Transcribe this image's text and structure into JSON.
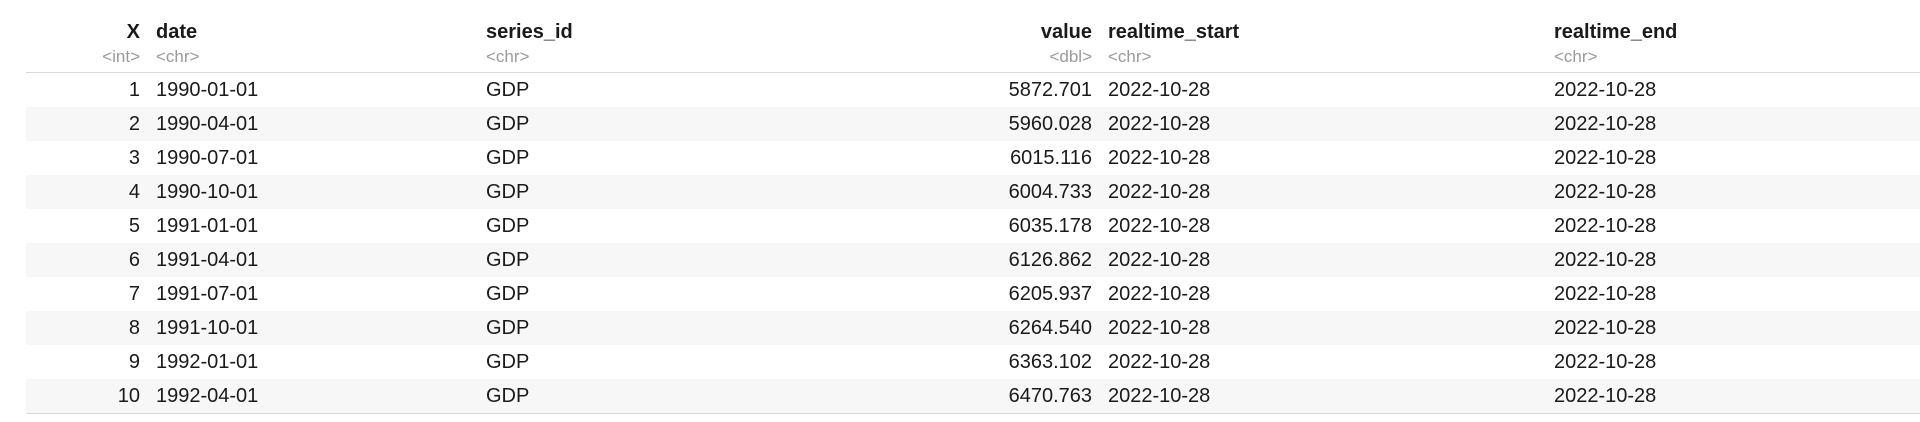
{
  "columns": [
    {
      "name": "X",
      "type": "<int>"
    },
    {
      "name": "date",
      "type": "<chr>"
    },
    {
      "name": "series_id",
      "type": "<chr>"
    },
    {
      "name": "value",
      "type": "<dbl>"
    },
    {
      "name": "realtime_start",
      "type": "<chr>"
    },
    {
      "name": "realtime_end",
      "type": "<chr>"
    }
  ],
  "rows": [
    [
      "1",
      "1990-01-01",
      "GDP",
      "5872.701",
      "2022-10-28",
      "2022-10-28"
    ],
    [
      "2",
      "1990-04-01",
      "GDP",
      "5960.028",
      "2022-10-28",
      "2022-10-28"
    ],
    [
      "3",
      "1990-07-01",
      "GDP",
      "6015.116",
      "2022-10-28",
      "2022-10-28"
    ],
    [
      "4",
      "1990-10-01",
      "GDP",
      "6004.733",
      "2022-10-28",
      "2022-10-28"
    ],
    [
      "5",
      "1991-01-01",
      "GDP",
      "6035.178",
      "2022-10-28",
      "2022-10-28"
    ],
    [
      "6",
      "1991-04-01",
      "GDP",
      "6126.862",
      "2022-10-28",
      "2022-10-28"
    ],
    [
      "7",
      "1991-07-01",
      "GDP",
      "6205.937",
      "2022-10-28",
      "2022-10-28"
    ],
    [
      "8",
      "1991-10-01",
      "GDP",
      "6264.540",
      "2022-10-28",
      "2022-10-28"
    ],
    [
      "9",
      "1992-01-01",
      "GDP",
      "6363.102",
      "2022-10-28",
      "2022-10-28"
    ],
    [
      "10",
      "1992-04-01",
      "GDP",
      "6470.763",
      "2022-10-28",
      "2022-10-28"
    ]
  ]
}
